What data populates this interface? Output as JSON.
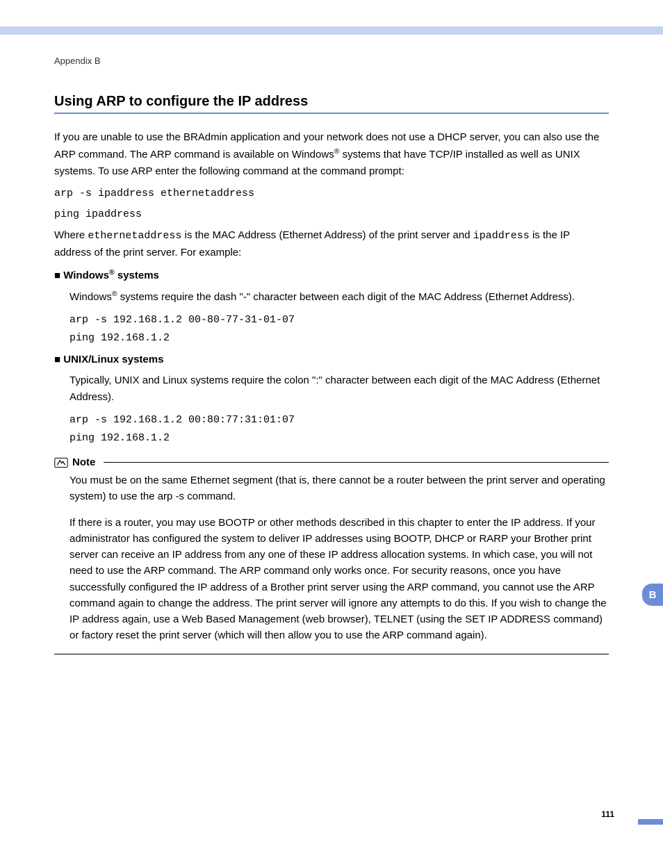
{
  "header": {
    "appendix": "Appendix B"
  },
  "title": "Using ARP to configure the IP address",
  "intro": {
    "p1a": "If you are unable to use the BRAdmin application and your network does not use a DHCP server, you can also use the ARP command. The ARP command is available on Windows",
    "p1b": " systems that have TCP/IP installed as well as UNIX systems. To use ARP enter the following command at the command prompt:"
  },
  "cmd1": "arp -s ipaddress ethernetaddress",
  "cmd2": "ping ipaddress",
  "where": {
    "a": "Where ",
    "eth": "ethernetaddress",
    "b": " is the MAC Address (Ethernet Address) of the print server and ",
    "ip": "ipaddress",
    "c": " is the IP address of the print server. For example:"
  },
  "windows": {
    "heading_a": "Windows",
    "heading_b": " systems",
    "body_a": "Windows",
    "body_b": " systems require the dash \"-\" character between each digit of the MAC Address (Ethernet Address).",
    "cmd1": "arp -s 192.168.1.2 00-80-77-31-01-07",
    "cmd2": "ping 192.168.1.2"
  },
  "unix": {
    "heading": "UNIX/Linux systems",
    "body": "Typically, UNIX and Linux systems require the colon \":\" character between each digit of the MAC Address (Ethernet Address).",
    "cmd1": "arp -s 192.168.1.2 00:80:77:31:01:07",
    "cmd2": "ping 192.168.1.2"
  },
  "note": {
    "title": "Note",
    "p1": "You must be on the same Ethernet segment (that is, there cannot be a router between the print server and operating system) to use the arp -s command.",
    "p2": "If there is a router, you may use BOOTP or other methods described in this chapter to enter the IP address. If your administrator has configured the system to deliver IP addresses using BOOTP, DHCP or RARP your Brother print server can receive an IP address from any one of these IP address allocation systems. In which case, you will not need to use the ARP command. The ARP command only works once. For security reasons, once you have successfully configured the IP address of a Brother print server using the ARP command, you cannot use the ARP command again to change the address. The print server will ignore any attempts to do this. If you wish to change the IP address again, use a Web Based Management (web browser), TELNET (using the SET IP ADDRESS command) or factory reset the print server (which will then allow you to use the ARP command again)."
  },
  "side_tab": "B",
  "page_number": "111",
  "reg": "®",
  "bullet": "■"
}
